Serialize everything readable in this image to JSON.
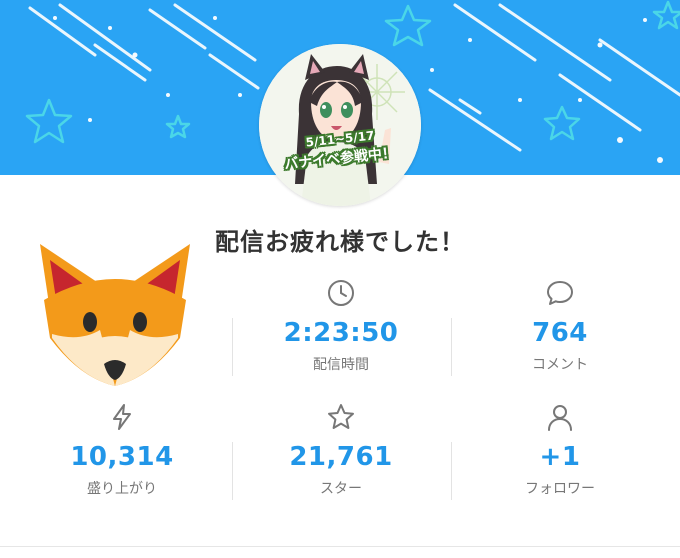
{
  "banner": {
    "color": "#2aa4f4"
  },
  "avatar": {
    "date_text": "5/11~5/17",
    "event_text": "バナイベ参戦中！"
  },
  "headline": "配信お疲れ様でした！",
  "stats": {
    "duration": {
      "icon": "clock-icon",
      "value": "2:23:50",
      "label": "配信時間"
    },
    "comments": {
      "icon": "comment-icon",
      "value": "764",
      "label": "コメント"
    },
    "excitement": {
      "icon": "lightning-icon",
      "value": "10,314",
      "label": "盛り上がり"
    },
    "stars": {
      "icon": "star-icon",
      "value": "21,761",
      "label": "スター"
    },
    "followers": {
      "icon": "user-icon",
      "value": "+1",
      "label": "フォロワー"
    }
  },
  "accent_color": "#2196e8"
}
